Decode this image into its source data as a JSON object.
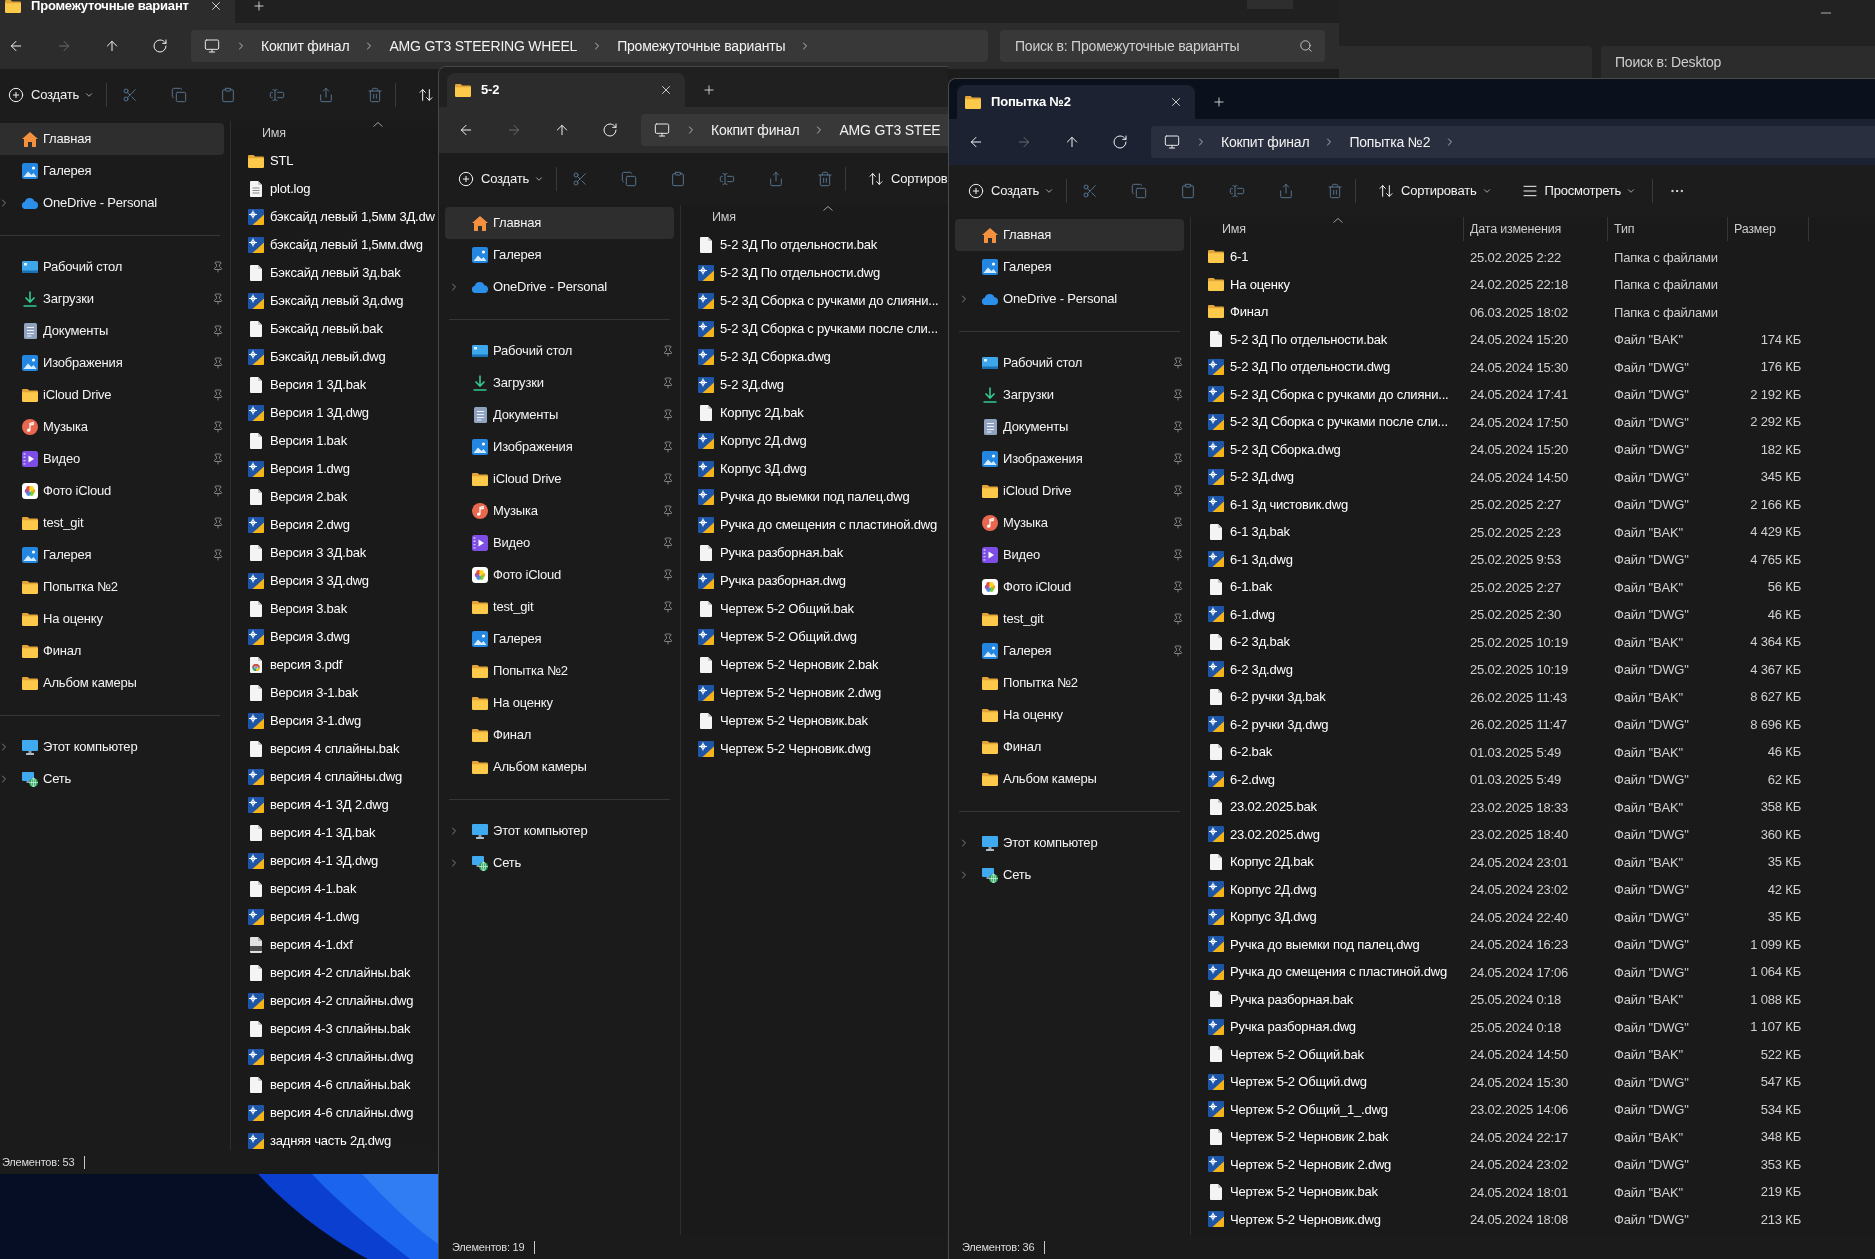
{
  "background_window": {
    "search": {
      "placeholder": "Поиск в: Desktop"
    }
  },
  "windows": [
    {
      "active": false,
      "tabs": [
        {
          "title": "Промежуточные вариант",
          "selected": true
        }
      ],
      "nav_buttons": [
        {
          "kind": "back",
          "disabled": false
        },
        {
          "kind": "forward",
          "disabled": true
        },
        {
          "kind": "up",
          "disabled": false
        },
        {
          "kind": "refresh",
          "disabled": false
        }
      ],
      "breadcrumb": [
        {
          "label": "Кокпит финал",
          "chevron": true
        },
        {
          "label": "AMG GT3 STEERING WHEEL",
          "chevron": true
        },
        {
          "label": "Промежуточные варианты",
          "chevron": true
        }
      ],
      "search": {
        "placeholder": "Поиск в: Промежуточные варианты"
      },
      "toolbar": [
        {
          "kind": "create",
          "label": "Создать",
          "disabled": false,
          "dropdown": true
        },
        {
          "kind": "cut",
          "disabled": true,
          "dropdown": false
        },
        {
          "kind": "copy",
          "disabled": true,
          "dropdown": false
        },
        {
          "kind": "paste",
          "disabled": true,
          "dropdown": false
        },
        {
          "kind": "rename",
          "disabled": true,
          "dropdown": false
        },
        {
          "kind": "share",
          "disabled": true,
          "dropdown": false
        },
        {
          "kind": "delete",
          "disabled": true,
          "dropdown": false
        },
        {
          "kind": "sort",
          "disabled": false,
          "dropdown": false
        }
      ],
      "sidebar": {
        "sections": [
          {
            "items": [
              {
                "label": "Главная",
                "kind": "home",
                "selected": true,
                "pinned": false,
                "expandable": false
              },
              {
                "label": "Галерея",
                "kind": "gallery",
                "selected": false,
                "pinned": false,
                "expandable": false
              },
              {
                "label": "OneDrive - Personal",
                "kind": "onedrive",
                "selected": false,
                "pinned": false,
                "expandable": true
              }
            ]
          },
          {
            "items": [
              {
                "label": "Рабочий стол",
                "kind": "desktop",
                "selected": false,
                "pinned": true,
                "expandable": false
              },
              {
                "label": "Загрузки",
                "kind": "downloads",
                "selected": false,
                "pinned": true,
                "expandable": false
              },
              {
                "label": "Документы",
                "kind": "documents",
                "selected": false,
                "pinned": true,
                "expandable": false
              },
              {
                "label": "Изображения",
                "kind": "gallery",
                "selected": false,
                "pinned": true,
                "expandable": false
              },
              {
                "label": "iCloud Drive",
                "kind": "folder",
                "selected": false,
                "pinned": true,
                "expandable": false
              },
              {
                "label": "Музыка",
                "kind": "music",
                "selected": false,
                "pinned": true,
                "expandable": false
              },
              {
                "label": "Видео",
                "kind": "video",
                "selected": false,
                "pinned": true,
                "expandable": false
              },
              {
                "label": "Фото iCloud",
                "kind": "photos",
                "selected": false,
                "pinned": true,
                "expandable": false
              },
              {
                "label": "test_git",
                "kind": "folder",
                "selected": false,
                "pinned": true,
                "expandable": false
              },
              {
                "label": "Галерея",
                "kind": "gallery",
                "selected": false,
                "pinned": true,
                "expandable": false
              },
              {
                "label": "Попытка №2",
                "kind": "folder",
                "selected": false,
                "pinned": false,
                "expandable": false
              },
              {
                "label": "На оценку",
                "kind": "folder",
                "selected": false,
                "pinned": false,
                "expandable": false
              },
              {
                "label": "Финал",
                "kind": "folder",
                "selected": false,
                "pinned": false,
                "expandable": false
              },
              {
                "label": "Альбом камеры",
                "kind": "folder",
                "selected": false,
                "pinned": false,
                "expandable": false
              }
            ]
          },
          {
            "items": [
              {
                "label": "Этот компьютер",
                "kind": "pc",
                "selected": false,
                "pinned": false,
                "expandable": true
              },
              {
                "label": "Сеть",
                "kind": "network",
                "selected": false,
                "pinned": false,
                "expandable": true
              }
            ]
          }
        ]
      },
      "list": {
        "columns": [
          {
            "label": "Имя",
            "sorted": true
          }
        ],
        "rows": [
          {
            "name": "STL",
            "kind": "folder",
            "selected": false
          },
          {
            "name": "plot.log",
            "kind": "log",
            "selected": false
          },
          {
            "name": "бэксайд левый 1,5мм 3Д.dw",
            "kind": "dwg",
            "selected": false
          },
          {
            "name": "бэксайд левый 1,5мм.dwg",
            "kind": "dwg",
            "selected": false
          },
          {
            "name": "Бэксайд левый 3д.bak",
            "kind": "bak",
            "selected": false
          },
          {
            "name": "Бэксайд левый 3д.dwg",
            "kind": "dwg",
            "selected": false
          },
          {
            "name": "Бэксайд левый.bak",
            "kind": "bak",
            "selected": false
          },
          {
            "name": "Бэксайд левый.dwg",
            "kind": "dwg",
            "selected": false
          },
          {
            "name": "Версия 1 3Д.bak",
            "kind": "bak",
            "selected": false
          },
          {
            "name": "Версия 1 3Д.dwg",
            "kind": "dwg",
            "selected": false
          },
          {
            "name": "Версия 1.bak",
            "kind": "bak",
            "selected": false
          },
          {
            "name": "Версия 1.dwg",
            "kind": "dwg",
            "selected": false
          },
          {
            "name": "Версия 2.bak",
            "kind": "bak",
            "selected": false
          },
          {
            "name": "Версия 2.dwg",
            "kind": "dwg",
            "selected": false
          },
          {
            "name": "Версия 3 3Д.bak",
            "kind": "bak",
            "selected": false
          },
          {
            "name": "Версия 3 3Д.dwg",
            "kind": "dwg",
            "selected": false
          },
          {
            "name": "Версия 3.bak",
            "kind": "bak",
            "selected": false
          },
          {
            "name": "Версия 3.dwg",
            "kind": "dwg",
            "selected": false
          },
          {
            "name": "версия 3.pdf",
            "kind": "pdf",
            "selected": false
          },
          {
            "name": "Версия 3-1.bak",
            "kind": "bak",
            "selected": false
          },
          {
            "name": "Версия 3-1.dwg",
            "kind": "dwg",
            "selected": false
          },
          {
            "name": "версия 4 сплайны.bak",
            "kind": "bak",
            "selected": false
          },
          {
            "name": "версия 4 сплайны.dwg",
            "kind": "dwg",
            "selected": false
          },
          {
            "name": "версия 4-1 3Д 2.dwg",
            "kind": "dwg",
            "selected": false
          },
          {
            "name": "версия 4-1 3Д.bak",
            "kind": "bak",
            "selected": false
          },
          {
            "name": "версия 4-1 3Д.dwg",
            "kind": "dwg",
            "selected": false
          },
          {
            "name": "версия 4-1.bak",
            "kind": "bak",
            "selected": false
          },
          {
            "name": "версия 4-1.dwg",
            "kind": "dwg",
            "selected": false
          },
          {
            "name": "версия 4-1.dxf",
            "kind": "dxf",
            "selected": false
          },
          {
            "name": "версия 4-2 сплайны.bak",
            "kind": "bak",
            "selected": false
          },
          {
            "name": "версия 4-2 сплайны.dwg",
            "kind": "dwg",
            "selected": false
          },
          {
            "name": "версия 4-3 сплайны.bak",
            "kind": "bak",
            "selected": false
          },
          {
            "name": "версия 4-3 сплайны.dwg",
            "kind": "dwg",
            "selected": false
          },
          {
            "name": "версия 4-6 сплайны.bak",
            "kind": "bak",
            "selected": false
          },
          {
            "name": "версия 4-6 сплайны.dwg",
            "kind": "dwg",
            "selected": false
          },
          {
            "name": "задняя часть 2д.dwg",
            "kind": "dwg",
            "selected": false
          }
        ]
      },
      "status_bar": {
        "text": "Элементов: 53"
      }
    },
    {
      "active": false,
      "tabs": [
        {
          "title": "5-2",
          "selected": true
        }
      ],
      "nav_buttons": [
        {
          "kind": "back",
          "disabled": false
        },
        {
          "kind": "forward",
          "disabled": true
        },
        {
          "kind": "up",
          "disabled": false
        },
        {
          "kind": "refresh",
          "disabled": false
        }
      ],
      "breadcrumb": [
        {
          "label": "Кокпит финал",
          "chevron": true
        },
        {
          "label": "AMG GT3 STEE",
          "chevron": false
        }
      ],
      "toolbar": [
        {
          "kind": "create",
          "label": "Создать",
          "disabled": false,
          "dropdown": true
        },
        {
          "kind": "cut",
          "disabled": true,
          "dropdown": false
        },
        {
          "kind": "copy",
          "disabled": true,
          "dropdown": false
        },
        {
          "kind": "paste",
          "disabled": true,
          "dropdown": false
        },
        {
          "kind": "rename",
          "disabled": true,
          "dropdown": false
        },
        {
          "kind": "share",
          "disabled": true,
          "dropdown": false
        },
        {
          "kind": "delete",
          "disabled": true,
          "dropdown": false
        },
        {
          "kind": "sort",
          "label": "Сортиров",
          "disabled": false,
          "dropdown": false
        }
      ],
      "sidebar": {
        "sections": [
          {
            "items": [
              {
                "label": "Главная",
                "kind": "home",
                "selected": true,
                "pinned": false,
                "expandable": false
              },
              {
                "label": "Галерея",
                "kind": "gallery",
                "selected": false,
                "pinned": false,
                "expandable": false
              },
              {
                "label": "OneDrive - Personal",
                "kind": "onedrive",
                "selected": false,
                "pinned": false,
                "expandable": true
              }
            ]
          },
          {
            "items": [
              {
                "label": "Рабочий стол",
                "kind": "desktop",
                "selected": false,
                "pinned": true,
                "expandable": false
              },
              {
                "label": "Загрузки",
                "kind": "downloads",
                "selected": false,
                "pinned": true,
                "expandable": false
              },
              {
                "label": "Документы",
                "kind": "documents",
                "selected": false,
                "pinned": true,
                "expandable": false
              },
              {
                "label": "Изображения",
                "kind": "gallery",
                "selected": false,
                "pinned": true,
                "expandable": false
              },
              {
                "label": "iCloud Drive",
                "kind": "folder",
                "selected": false,
                "pinned": true,
                "expandable": false
              },
              {
                "label": "Музыка",
                "kind": "music",
                "selected": false,
                "pinned": true,
                "expandable": false
              },
              {
                "label": "Видео",
                "kind": "video",
                "selected": false,
                "pinned": true,
                "expandable": false
              },
              {
                "label": "Фото iCloud",
                "kind": "photos",
                "selected": false,
                "pinned": true,
                "expandable": false
              },
              {
                "label": "test_git",
                "kind": "folder",
                "selected": false,
                "pinned": true,
                "expandable": false
              },
              {
                "label": "Галерея",
                "kind": "gallery",
                "selected": false,
                "pinned": true,
                "expandable": false
              },
              {
                "label": "Попытка №2",
                "kind": "folder",
                "selected": false,
                "pinned": false,
                "expandable": false
              },
              {
                "label": "На оценку",
                "kind": "folder",
                "selected": false,
                "pinned": false,
                "expandable": false
              },
              {
                "label": "Финал",
                "kind": "folder",
                "selected": false,
                "pinned": false,
                "expandable": false
              },
              {
                "label": "Альбом камеры",
                "kind": "folder",
                "selected": false,
                "pinned": false,
                "expandable": false
              }
            ]
          },
          {
            "items": [
              {
                "label": "Этот компьютер",
                "kind": "pc",
                "selected": false,
                "pinned": false,
                "expandable": true
              },
              {
                "label": "Сеть",
                "kind": "network",
                "selected": false,
                "pinned": false,
                "expandable": true
              }
            ]
          }
        ]
      },
      "list": {
        "columns": [
          {
            "label": "Имя",
            "sorted": true
          }
        ],
        "rows": [
          {
            "name": "5-2 3Д По отдельности.bak",
            "kind": "bak",
            "selected": false
          },
          {
            "name": "5-2 3Д По отдельности.dwg",
            "kind": "dwg",
            "selected": false
          },
          {
            "name": "5-2 3Д Сборка с ручками до слияни...",
            "kind": "dwg",
            "selected": false
          },
          {
            "name": "5-2 3Д Сборка с ручками после сли...",
            "kind": "dwg",
            "selected": false
          },
          {
            "name": "5-2 3Д Сборка.dwg",
            "kind": "dwg",
            "selected": false
          },
          {
            "name": "5-2 3Д.dwg",
            "kind": "dwg",
            "selected": false
          },
          {
            "name": "Корпус 2Д.bak",
            "kind": "bak",
            "selected": false
          },
          {
            "name": "Корпус 2Д.dwg",
            "kind": "dwg",
            "selected": false
          },
          {
            "name": "Корпус 3Д.dwg",
            "kind": "dwg",
            "selected": false
          },
          {
            "name": "Ручка до выемки под палец.dwg",
            "kind": "dwg",
            "selected": false
          },
          {
            "name": "Ручка до смещения с пластиной.dwg",
            "kind": "dwg",
            "selected": false
          },
          {
            "name": "Ручка разборная.bak",
            "kind": "bak",
            "selected": false
          },
          {
            "name": "Ручка разборная.dwg",
            "kind": "dwg",
            "selected": false
          },
          {
            "name": "Чертеж 5-2 Общий.bak",
            "kind": "bak",
            "selected": false
          },
          {
            "name": "Чертеж 5-2 Общий.dwg",
            "kind": "dwg",
            "selected": false
          },
          {
            "name": "Чертеж 5-2 Черновик 2.bak",
            "kind": "bak",
            "selected": false
          },
          {
            "name": "Чертеж 5-2 Черновик 2.dwg",
            "kind": "dwg",
            "selected": false
          },
          {
            "name": "Чертеж 5-2 Черновик.bak",
            "kind": "bak",
            "selected": false
          },
          {
            "name": "Чертеж 5-2 Черновик.dwg",
            "kind": "dwg",
            "selected": false
          }
        ]
      },
      "status_bar": {
        "text": "Элементов: 19"
      }
    },
    {
      "active": true,
      "tabs": [
        {
          "title": "Попытка №2",
          "selected": true
        }
      ],
      "nav_buttons": [
        {
          "kind": "back",
          "disabled": false
        },
        {
          "kind": "forward",
          "disabled": true
        },
        {
          "kind": "up",
          "disabled": false
        },
        {
          "kind": "refresh",
          "disabled": false
        }
      ],
      "breadcrumb": [
        {
          "label": "Кокпит финал",
          "chevron": true
        },
        {
          "label": "Попытка №2",
          "chevron": true
        }
      ],
      "toolbar": [
        {
          "kind": "create",
          "label": "Создать",
          "disabled": false,
          "dropdown": true
        },
        {
          "kind": "cut",
          "disabled": true,
          "dropdown": false
        },
        {
          "kind": "copy",
          "disabled": true,
          "dropdown": false
        },
        {
          "kind": "paste",
          "disabled": true,
          "dropdown": false
        },
        {
          "kind": "rename",
          "disabled": true,
          "dropdown": false
        },
        {
          "kind": "share",
          "disabled": true,
          "dropdown": false
        },
        {
          "kind": "delete",
          "disabled": true,
          "dropdown": false
        },
        {
          "kind": "sort",
          "label": "Сортировать",
          "disabled": false,
          "dropdown": true
        },
        {
          "kind": "view",
          "label": "Просмотреть",
          "disabled": false,
          "dropdown": true
        },
        {
          "kind": "more",
          "disabled": false,
          "dropdown": false
        }
      ],
      "sidebar": {
        "sections": [
          {
            "items": [
              {
                "label": "Главная",
                "kind": "home",
                "selected": true,
                "pinned": false,
                "expandable": false
              },
              {
                "label": "Галерея",
                "kind": "gallery",
                "selected": false,
                "pinned": false,
                "expandable": false
              },
              {
                "label": "OneDrive - Personal",
                "kind": "onedrive",
                "selected": false,
                "pinned": false,
                "expandable": true
              }
            ]
          },
          {
            "items": [
              {
                "label": "Рабочий стол",
                "kind": "desktop",
                "selected": false,
                "pinned": true,
                "expandable": false
              },
              {
                "label": "Загрузки",
                "kind": "downloads",
                "selected": false,
                "pinned": true,
                "expandable": false
              },
              {
                "label": "Документы",
                "kind": "documents",
                "selected": false,
                "pinned": true,
                "expandable": false
              },
              {
                "label": "Изображения",
                "kind": "gallery",
                "selected": false,
                "pinned": true,
                "expandable": false
              },
              {
                "label": "iCloud Drive",
                "kind": "folder",
                "selected": false,
                "pinned": true,
                "expandable": false
              },
              {
                "label": "Музыка",
                "kind": "music",
                "selected": false,
                "pinned": true,
                "expandable": false
              },
              {
                "label": "Видео",
                "kind": "video",
                "selected": false,
                "pinned": true,
                "expandable": false
              },
              {
                "label": "Фото iCloud",
                "kind": "photos",
                "selected": false,
                "pinned": true,
                "expandable": false
              },
              {
                "label": "test_git",
                "kind": "folder",
                "selected": false,
                "pinned": true,
                "expandable": false
              },
              {
                "label": "Галерея",
                "kind": "gallery",
                "selected": false,
                "pinned": true,
                "expandable": false
              },
              {
                "label": "Попытка №2",
                "kind": "folder",
                "selected": false,
                "pinned": false,
                "expandable": false
              },
              {
                "label": "На оценку",
                "kind": "folder",
                "selected": false,
                "pinned": false,
                "expandable": false
              },
              {
                "label": "Финал",
                "kind": "folder",
                "selected": false,
                "pinned": false,
                "expandable": false
              },
              {
                "label": "Альбом камеры",
                "kind": "folder",
                "selected": false,
                "pinned": false,
                "expandable": false
              }
            ]
          },
          {
            "items": [
              {
                "label": "Этот компьютер",
                "kind": "pc",
                "selected": false,
                "pinned": false,
                "expandable": true
              },
              {
                "label": "Сеть",
                "kind": "network",
                "selected": false,
                "pinned": false,
                "expandable": true
              }
            ]
          }
        ]
      },
      "list": {
        "columns": [
          {
            "label": "Имя",
            "sorted": true
          },
          {
            "label": "Дата изменения",
            "sorted": false
          },
          {
            "label": "Тип",
            "sorted": false
          },
          {
            "label": "Размер",
            "sorted": false
          }
        ],
        "rows": [
          {
            "name": "6-1",
            "kind": "folder",
            "modified": "25.02.2025 2:22",
            "type": "Папка с файлами",
            "selected": false
          },
          {
            "name": "На оценку",
            "kind": "folder",
            "modified": "24.02.2025 22:18",
            "type": "Папка с файлами",
            "selected": false
          },
          {
            "name": "Финал",
            "kind": "folder",
            "modified": "06.03.2025 18:02",
            "type": "Папка с файлами",
            "selected": false
          },
          {
            "name": "5-2 3Д По отдельности.bak",
            "kind": "bak",
            "modified": "24.05.2024 15:20",
            "type": "Файл \"BAK\"",
            "size": "174 КБ",
            "selected": false
          },
          {
            "name": "5-2 3Д По отдельности.dwg",
            "kind": "dwg",
            "modified": "24.05.2024 15:30",
            "type": "Файл \"DWG\"",
            "size": "176 КБ",
            "selected": false
          },
          {
            "name": "5-2 3Д Сборка с ручками до слияни...",
            "kind": "dwg",
            "modified": "24.05.2024 17:41",
            "type": "Файл \"DWG\"",
            "size": "2 192 КБ",
            "selected": false
          },
          {
            "name": "5-2 3Д Сборка с ручками после сли...",
            "kind": "dwg",
            "modified": "24.05.2024 17:50",
            "type": "Файл \"DWG\"",
            "size": "2 292 КБ",
            "selected": false
          },
          {
            "name": "5-2 3Д Сборка.dwg",
            "kind": "dwg",
            "modified": "24.05.2024 15:20",
            "type": "Файл \"DWG\"",
            "size": "182 КБ",
            "selected": false
          },
          {
            "name": "5-2 3Д.dwg",
            "kind": "dwg",
            "modified": "24.05.2024 14:50",
            "type": "Файл \"DWG\"",
            "size": "345 КБ",
            "selected": false
          },
          {
            "name": "6-1 3д чистовик.dwg",
            "kind": "dwg",
            "modified": "25.02.2025 2:27",
            "type": "Файл \"DWG\"",
            "size": "2 166 КБ",
            "selected": false
          },
          {
            "name": "6-1 3д.bak",
            "kind": "bak",
            "modified": "25.02.2025 2:23",
            "type": "Файл \"BAK\"",
            "size": "4 429 КБ",
            "selected": false
          },
          {
            "name": "6-1 3д.dwg",
            "kind": "dwg",
            "modified": "25.02.2025 9:53",
            "type": "Файл \"DWG\"",
            "size": "4 765 КБ",
            "selected": false
          },
          {
            "name": "6-1.bak",
            "kind": "bak",
            "modified": "25.02.2025 2:27",
            "type": "Файл \"BAK\"",
            "size": "56 КБ",
            "selected": false
          },
          {
            "name": "6-1.dwg",
            "kind": "dwg",
            "modified": "25.02.2025 2:30",
            "type": "Файл \"DWG\"",
            "size": "46 КБ",
            "selected": false
          },
          {
            "name": "6-2 3д.bak",
            "kind": "bak",
            "modified": "25.02.2025 10:19",
            "type": "Файл \"BAK\"",
            "size": "4 364 КБ",
            "selected": false
          },
          {
            "name": "6-2 3д.dwg",
            "kind": "dwg",
            "modified": "25.02.2025 10:19",
            "type": "Файл \"DWG\"",
            "size": "4 367 КБ",
            "selected": false
          },
          {
            "name": "6-2 ручки 3д.bak",
            "kind": "bak",
            "modified": "26.02.2025 11:43",
            "type": "Файл \"BAK\"",
            "size": "8 627 КБ",
            "selected": false
          },
          {
            "name": "6-2 ручки 3д.dwg",
            "kind": "dwg",
            "modified": "26.02.2025 11:47",
            "type": "Файл \"DWG\"",
            "size": "8 696 КБ",
            "selected": false
          },
          {
            "name": "6-2.bak",
            "kind": "bak",
            "modified": "01.03.2025 5:49",
            "type": "Файл \"BAK\"",
            "size": "46 КБ",
            "selected": false
          },
          {
            "name": "6-2.dwg",
            "kind": "dwg",
            "modified": "01.03.2025 5:49",
            "type": "Файл \"DWG\"",
            "size": "62 КБ",
            "selected": false
          },
          {
            "name": "23.02.2025.bak",
            "kind": "bak",
            "modified": "23.02.2025 18:33",
            "type": "Файл \"BAK\"",
            "size": "358 КБ",
            "selected": false
          },
          {
            "name": "23.02.2025.dwg",
            "kind": "dwg",
            "modified": "23.02.2025 18:40",
            "type": "Файл \"DWG\"",
            "size": "360 КБ",
            "selected": false
          },
          {
            "name": "Корпус 2Д.bak",
            "kind": "bak",
            "modified": "24.05.2024 23:01",
            "type": "Файл \"BAK\"",
            "size": "35 КБ",
            "selected": false
          },
          {
            "name": "Корпус 2Д.dwg",
            "kind": "dwg",
            "modified": "24.05.2024 23:02",
            "type": "Файл \"DWG\"",
            "size": "42 КБ",
            "selected": false
          },
          {
            "name": "Корпус 3Д.dwg",
            "kind": "dwg",
            "modified": "24.05.2024 22:40",
            "type": "Файл \"DWG\"",
            "size": "35 КБ",
            "selected": false
          },
          {
            "name": "Ручка до выемки под палец.dwg",
            "kind": "dwg",
            "modified": "24.05.2024 16:23",
            "type": "Файл \"DWG\"",
            "size": "1 099 КБ",
            "selected": false
          },
          {
            "name": "Ручка до смещения с пластиной.dwg",
            "kind": "dwg",
            "modified": "24.05.2024 17:06",
            "type": "Файл \"DWG\"",
            "size": "1 064 КБ",
            "selected": false
          },
          {
            "name": "Ручка разборная.bak",
            "kind": "bak",
            "modified": "25.05.2024 0:18",
            "type": "Файл \"BAK\"",
            "size": "1 088 КБ",
            "selected": false
          },
          {
            "name": "Ручка разборная.dwg",
            "kind": "dwg",
            "modified": "25.05.2024 0:18",
            "type": "Файл \"DWG\"",
            "size": "1 107 КБ",
            "selected": false
          },
          {
            "name": "Чертеж 5-2 Общий.bak",
            "kind": "bak",
            "modified": "24.05.2024 14:50",
            "type": "Файл \"BAK\"",
            "size": "522 КБ",
            "selected": false
          },
          {
            "name": "Чертеж 5-2 Общий.dwg",
            "kind": "dwg",
            "modified": "24.05.2024 15:30",
            "type": "Файл \"DWG\"",
            "size": "547 КБ",
            "selected": false
          },
          {
            "name": "Чертеж 5-2 Общий_1_.dwg",
            "kind": "dwg",
            "modified": "23.02.2025 14:06",
            "type": "Файл \"DWG\"",
            "size": "534 КБ",
            "selected": false
          },
          {
            "name": "Чертеж 5-2 Черновик 2.bak",
            "kind": "bak",
            "modified": "24.05.2024 22:17",
            "type": "Файл \"BAK\"",
            "size": "348 КБ",
            "selected": false
          },
          {
            "name": "Чертеж 5-2 Черновик 2.dwg",
            "kind": "dwg",
            "modified": "24.05.2024 23:02",
            "type": "Файл \"DWG\"",
            "size": "353 КБ",
            "selected": false
          },
          {
            "name": "Чертеж 5-2 Черновик.bak",
            "kind": "bak",
            "modified": "24.05.2024 18:01",
            "type": "Файл \"BAK\"",
            "size": "219 КБ",
            "selected": false
          },
          {
            "name": "Чертеж 5-2 Черновик.dwg",
            "kind": "dwg",
            "modified": "24.05.2024 18:08",
            "type": "Файл \"DWG\"",
            "size": "213 КБ",
            "selected": false
          }
        ]
      },
      "status_bar": {
        "text": "Элементов: 36"
      }
    }
  ]
}
